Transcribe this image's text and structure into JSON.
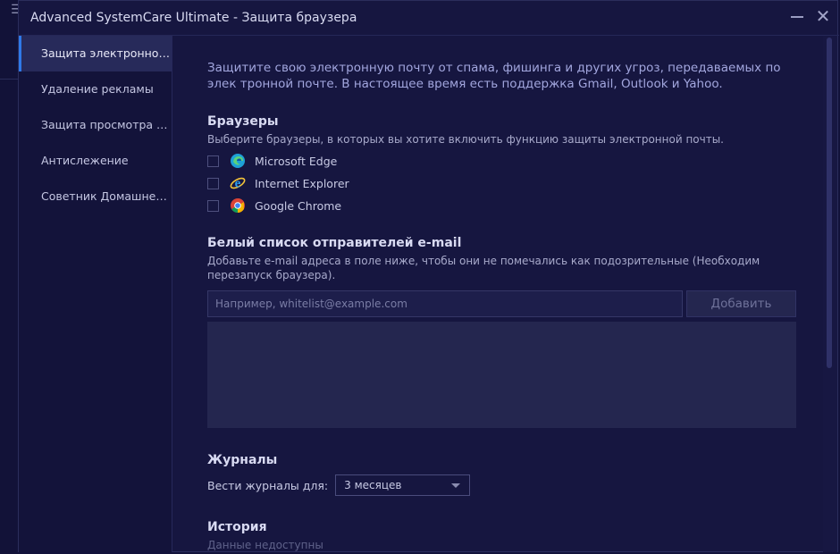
{
  "window": {
    "title": "Advanced SystemCare Ultimate - Защита браузера"
  },
  "sidebar": {
    "items": [
      {
        "label": "Защита электронной ...",
        "active": true
      },
      {
        "label": "Удаление рекламы"
      },
      {
        "label": "Защита просмотра в ..."
      },
      {
        "label": "Антислежение"
      },
      {
        "label": "Советник Домашней с..."
      }
    ]
  },
  "main": {
    "intro": "Защитите свою электронную почту от спама, фишинга и других угроз, передаваемых по элек тронной почте. В настоящее время есть  поддержка Gmail, Outlook и Yahoo.",
    "browsers": {
      "title": "Браузеры",
      "description": "Выберите браузеры, в которых вы хотите включить функцию защиты  электронной почты.",
      "items": [
        {
          "label": "Microsoft Edge",
          "icon": "edge-icon",
          "checked": false
        },
        {
          "label": "Internet Explorer",
          "icon": "ie-icon",
          "checked": false
        },
        {
          "label": "Google Chrome",
          "icon": "chrome-icon",
          "checked": false
        }
      ]
    },
    "whitelist": {
      "title": "Белый список отправителей e-mail",
      "description": "Добавьте e-mail адреса в поле ниже, чтобы они не помечались как подозрительные (Необходим перезапуск браузера).",
      "placeholder": "Например, whitelist@example.com",
      "add_label": "Добавить"
    },
    "logs": {
      "title": "Журналы",
      "label": "Вести журналы для:",
      "selected": "3 месяцев"
    },
    "history": {
      "title": "История",
      "status": "Данные недоступны"
    }
  },
  "colors": {
    "background": "#161640",
    "sidebar_active": "#272a5a",
    "accent": "#2f79e8",
    "intro_text": "#a2a6de"
  }
}
